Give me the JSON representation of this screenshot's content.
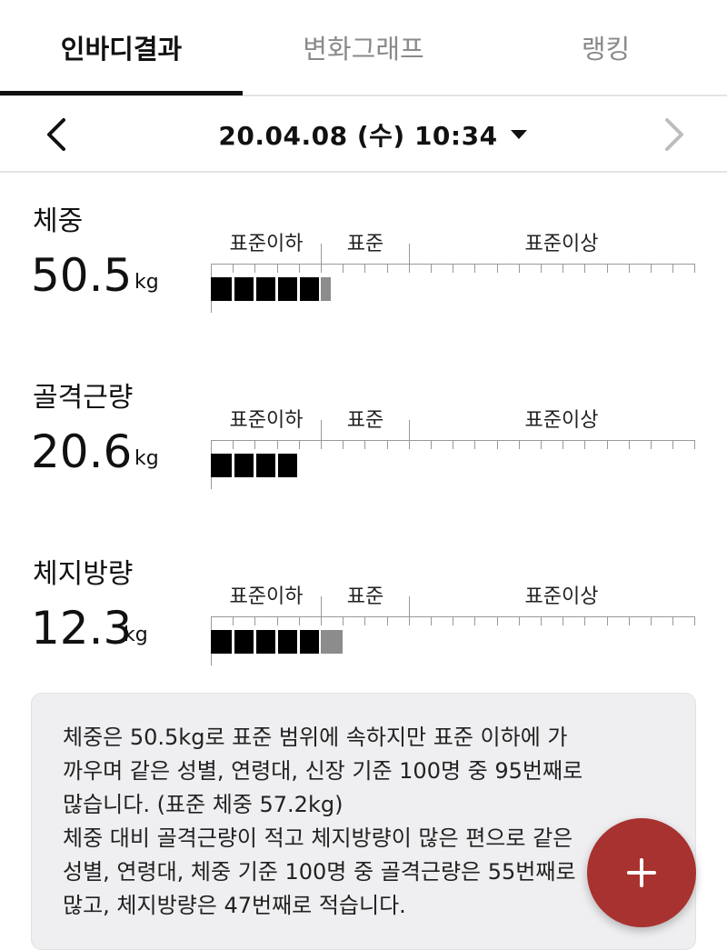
{
  "tabs": [
    {
      "label": "인바디결과",
      "active": true
    },
    {
      "label": "변화그래프",
      "active": false
    },
    {
      "label": "랭킹",
      "active": false
    }
  ],
  "date_bar": {
    "date": "20.04.08 (수) 10:34",
    "prev_icon": "chevron-left-icon",
    "next_icon": "chevron-right-icon",
    "dropdown_icon": "caret-down-icon"
  },
  "scale_labels": {
    "below": "표준이하",
    "standard": "표준",
    "above": "표준이상"
  },
  "metrics": [
    {
      "label": "체중",
      "value": "50.5",
      "unit": "kg",
      "black_segments": 5,
      "gray_fraction": 0.45
    },
    {
      "label": "골격근량",
      "value": "20.6",
      "unit": "kg",
      "black_segments": 4,
      "gray_fraction": 0
    },
    {
      "label": "체지방량",
      "value": "12.3",
      "unit": "kg",
      "black_segments": 5,
      "gray_fraction": 1.0
    }
  ],
  "summary": {
    "lines": [
      "체중은 50.5kg로 표준 범위에 속하지만 표준 이하에 가",
      "까우며 같은 성별, 연령대, 신장 기준 100명 중 95번째로",
      "많습니다. (표준 체중 57.2kg)",
      "체중 대비 골격근량이 적고 체지방량이 많은 편으로 같은",
      "성별, 연령대, 체중 기준 100명 중 골격근량은 55번째로",
      "많고, 체지방량은 47번째로 적습니다."
    ]
  },
  "fab": {
    "icon": "plus-icon"
  },
  "colors": {
    "fab": "#a8322f",
    "bar": "#000000",
    "bar_partial": "#8c8c8c",
    "summary_bg": "#efeff1"
  }
}
